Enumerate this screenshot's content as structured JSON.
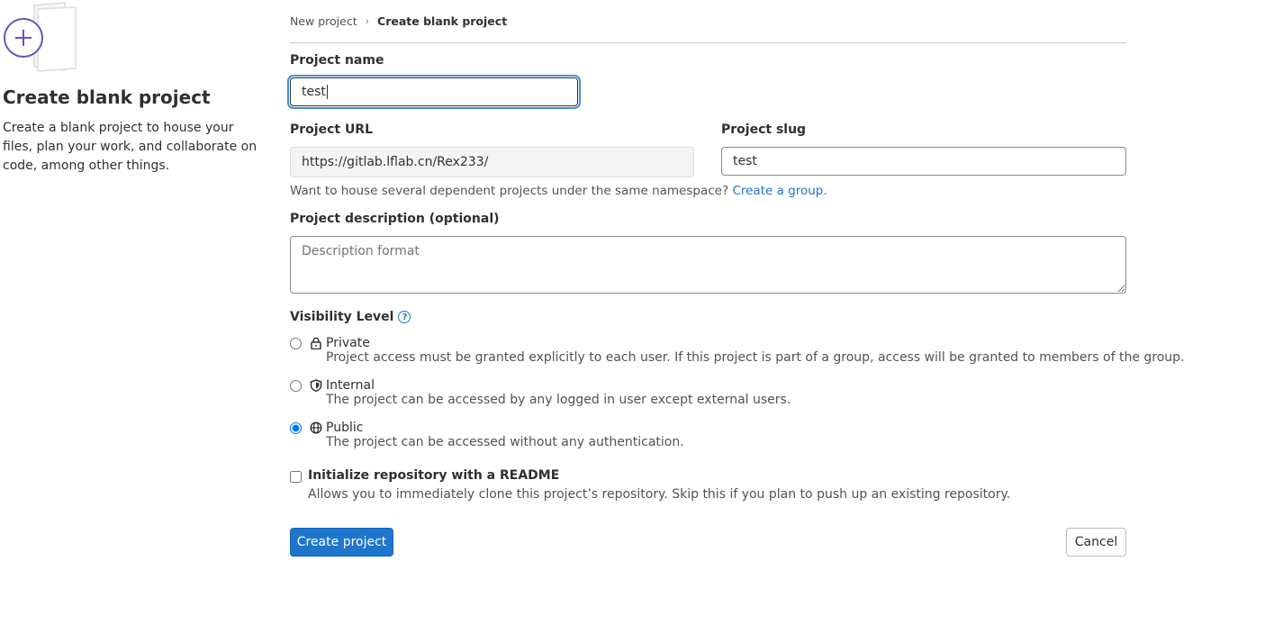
{
  "intro": {
    "title": "Create blank project",
    "description": "Create a blank project to house your files, plan your work, and collaborate on code, among other things."
  },
  "breadcrumb": {
    "parent": "New project",
    "separator": "›",
    "current": "Create blank project"
  },
  "form": {
    "project_name_label": "Project name",
    "project_name_value": "test",
    "project_url_label": "Project URL",
    "project_url_value": "https://gitlab.lflab.cn/Rex233/",
    "project_slug_label": "Project slug",
    "project_slug_value": "test",
    "namespace_help": "Want to house several dependent projects under the same namespace?",
    "create_group_link": "Create a group.",
    "description_label": "Project description (optional)",
    "description_placeholder": "Description format",
    "visibility_label": "Visibility Level",
    "visibility_help_icon": "question-circle-icon",
    "visibility_options": [
      {
        "icon": "lock-icon",
        "title": "Private",
        "description": "Project access must be granted explicitly to each user. If this project is part of a group, access will be granted to members of the group.",
        "selected": false
      },
      {
        "icon": "shield-icon",
        "title": "Internal",
        "description": "The project can be accessed by any logged in user except external users.",
        "selected": false
      },
      {
        "icon": "earth-icon",
        "title": "Public",
        "description": "The project can be accessed without any authentication.",
        "selected": true
      }
    ],
    "readme_label": "Initialize repository with a README",
    "readme_description": "Allows you to immediately clone this project’s repository. Skip this if you plan to push up an existing repository.",
    "readme_checked": false
  },
  "actions": {
    "create_label": "Create project",
    "cancel_label": "Cancel"
  },
  "colors": {
    "primary": "#1f75cb",
    "illustration_accent": "#6b4fbb",
    "focus_ring": "#428fdc"
  }
}
